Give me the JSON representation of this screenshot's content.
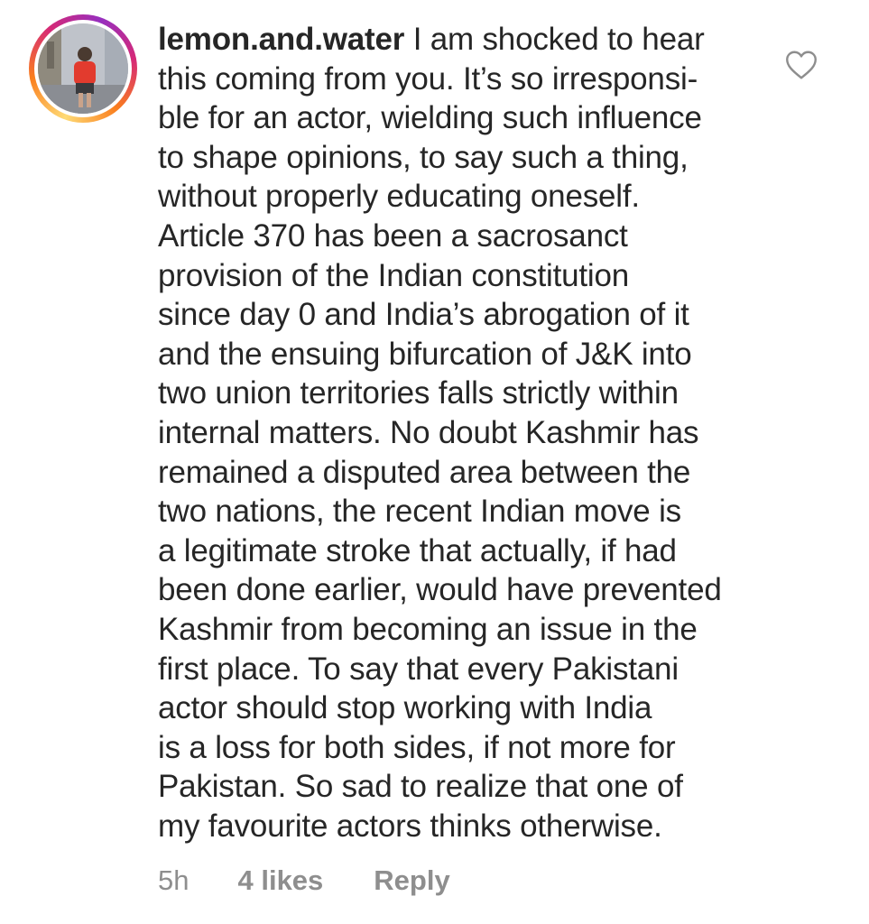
{
  "comment": {
    "username": "lemon.and.water",
    "first_line_text": " I am shocked to hear",
    "lines": [
      "this coming from you. It’s so irresponsi-",
      "ble for an actor, wielding such influence",
      "to shape opinions, to say such a thing,",
      "without properly educating oneself.",
      "Article 370 has been a sacrosanct",
      "provision of the Indian constitution",
      "since day 0 and India’s abrogation of it",
      "and the ensuing bifurcation of J&K into",
      "two union territories falls strictly within",
      "internal matters. No doubt Kashmir has",
      "remained a disputed area between the",
      "two nations, the recent Indian move is",
      "a legitimate stroke that actually, if had",
      "been done earlier, would have prevented",
      "Kashmir from becoming an issue in the",
      "first place. To say that every Pakistani",
      "actor should stop working with India",
      "is a loss for both sides, if not more for",
      "Pakistan. So sad to realize that one of",
      "my favourite actors thinks otherwise."
    ],
    "time": "5h",
    "likes": "4 likes",
    "reply_label": "Reply"
  },
  "icons": {
    "like": "heart-outline-icon",
    "avatar": "profile-photo"
  },
  "colors": {
    "text": "#262626",
    "meta": "#8e8e8e",
    "heart": "#8e8e8e"
  }
}
